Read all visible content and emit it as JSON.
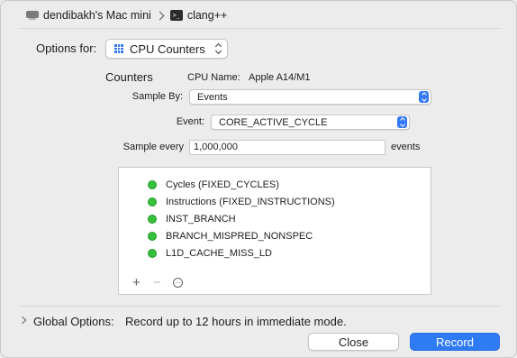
{
  "breadcrumb": {
    "device": "dendibakh's Mac mini",
    "target": "clang++",
    "terminal_glyph": ">_"
  },
  "options_for": {
    "label": "Options for:",
    "value": "CPU Counters"
  },
  "counters": {
    "heading": "Counters",
    "cpu_name_label": "CPU Name:",
    "cpu_name_value": "Apple A14/M1"
  },
  "sample_by": {
    "label": "Sample By:",
    "value": "Events"
  },
  "event": {
    "label": "Event:",
    "value": "CORE_ACTIVE_CYCLE"
  },
  "sample_every": {
    "label": "Sample every",
    "value": "1,000,000",
    "unit": "events"
  },
  "events_list": [
    "Cycles (FIXED_CYCLES)",
    "Instructions (FIXED_INSTRUCTIONS)",
    "INST_BRANCH",
    "BRANCH_MISPRED_NONSPEC",
    "L1D_CACHE_MISS_LD"
  ],
  "list_controls": {
    "add": "+",
    "remove": "−",
    "more": "···"
  },
  "global_options": {
    "label": "Global Options:",
    "value": "Record up to 12 hours in immediate mode."
  },
  "buttons": {
    "close": "Close",
    "record": "Record"
  },
  "colors": {
    "accent": "#2f7bf5",
    "event_status": "#36c03b"
  }
}
